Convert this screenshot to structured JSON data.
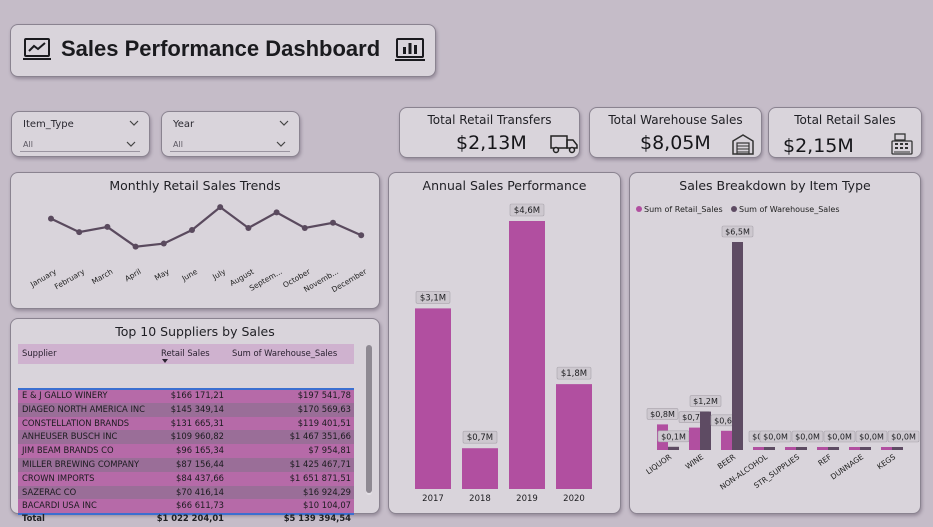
{
  "header": {
    "title": "Sales Performance Dashboard",
    "left_icon": "line-chart-icon",
    "right_icon": "bar-chart-icon"
  },
  "slicers": [
    {
      "label": "Item_Type",
      "value": "All"
    },
    {
      "label": "Year",
      "value": "All"
    }
  ],
  "kpis": [
    {
      "label": "Total Retail Transfers",
      "value": "$2,13M",
      "icon": "truck-icon"
    },
    {
      "label": "Total Warehouse Sales",
      "value": "$8,05M",
      "icon": "warehouse-icon"
    },
    {
      "label": "Total Retail Sales",
      "value": "$2,15M",
      "icon": "cash-register-icon"
    }
  ],
  "colors": {
    "retail": "#b14fa0",
    "warehouse": "#5e4b63",
    "line": "#5a4a5e",
    "background": "#c5bcc8",
    "card": "#d9d4db"
  },
  "monthly_chart": {
    "title": "Monthly Retail Sales Trends",
    "chart_data": {
      "type": "line",
      "categories": [
        "January",
        "February",
        "March",
        "April",
        "May",
        "June",
        "July",
        "August",
        "Septem...",
        "October",
        "Novemb...",
        "December"
      ],
      "values": [
        0.65,
        0.52,
        0.57,
        0.38,
        0.41,
        0.54,
        0.76,
        0.56,
        0.71,
        0.56,
        0.61,
        0.49
      ]
    }
  },
  "annual_chart": {
    "title": "Annual Sales Performance",
    "chart_data": {
      "type": "bar",
      "categories": [
        "2017",
        "2018",
        "2019",
        "2020"
      ],
      "values": [
        3.1,
        0.7,
        4.6,
        1.8
      ],
      "data_labels": [
        "$3,1M",
        "$0,7M",
        "$4,6M",
        "$1,8M"
      ],
      "ylim": [
        0,
        4.6
      ]
    }
  },
  "breakdown_chart": {
    "title": "Sales Breakdown by Item Type",
    "chart_data": {
      "type": "bar",
      "categories": [
        "LIQUOR",
        "WINE",
        "BEER",
        "NON-ALCOHOL",
        "STR_SUPPLIES",
        "REF",
        "DUNNAGE",
        "KEGS"
      ],
      "series": [
        {
          "name": "Sum of Retail_Sales",
          "values": [
            0.8,
            0.7,
            0.6,
            0.0,
            0.0,
            0.0,
            0.0,
            0.0
          ],
          "labels": [
            "$0,8M",
            "$0,7M",
            "$0,6M",
            "$0,0M",
            "",
            "",
            "",
            ""
          ]
        },
        {
          "name": "Sum of Warehouse_Sales",
          "values": [
            0.1,
            1.2,
            6.5,
            0.0,
            0.0,
            0.0,
            0.0,
            0.0
          ],
          "labels": [
            "$0,1M",
            "$1,2M",
            "$6,5M",
            "$0,0M",
            "$0,0M",
            "$0,0M",
            "$0,0M",
            "$0,0M"
          ]
        }
      ],
      "legend": "top-left",
      "ylim": [
        0,
        6.5
      ]
    }
  },
  "suppliers_table": {
    "title": "Top 10 Suppliers by Sales",
    "columns": [
      "Supplier",
      "Retail Sales",
      "Sum of Warehouse_Sales"
    ],
    "rows": [
      [
        "E & J GALLO WINERY",
        "$166 171,21",
        "$197 541,78"
      ],
      [
        "DIAGEO NORTH AMERICA INC",
        "$145 349,14",
        "$170 569,63"
      ],
      [
        "CONSTELLATION BRANDS",
        "$131 665,31",
        "$119 401,51"
      ],
      [
        "ANHEUSER BUSCH INC",
        "$109 960,82",
        "$1 467 351,66"
      ],
      [
        "JIM BEAM BRANDS CO",
        "$96 165,34",
        "$7 954,81"
      ],
      [
        "MILLER BREWING COMPANY",
        "$87 156,44",
        "$1 425 467,71"
      ],
      [
        "CROWN IMPORTS",
        "$84 437,66",
        "$1 651 871,51"
      ],
      [
        "SAZERAC CO",
        "$70 416,14",
        "$16 924,29"
      ],
      [
        "BACARDI USA INC",
        "$66 611,73",
        "$10 104,07"
      ]
    ],
    "total": [
      "Total",
      "$1 022 204,01",
      "$5 139 394,54"
    ]
  }
}
